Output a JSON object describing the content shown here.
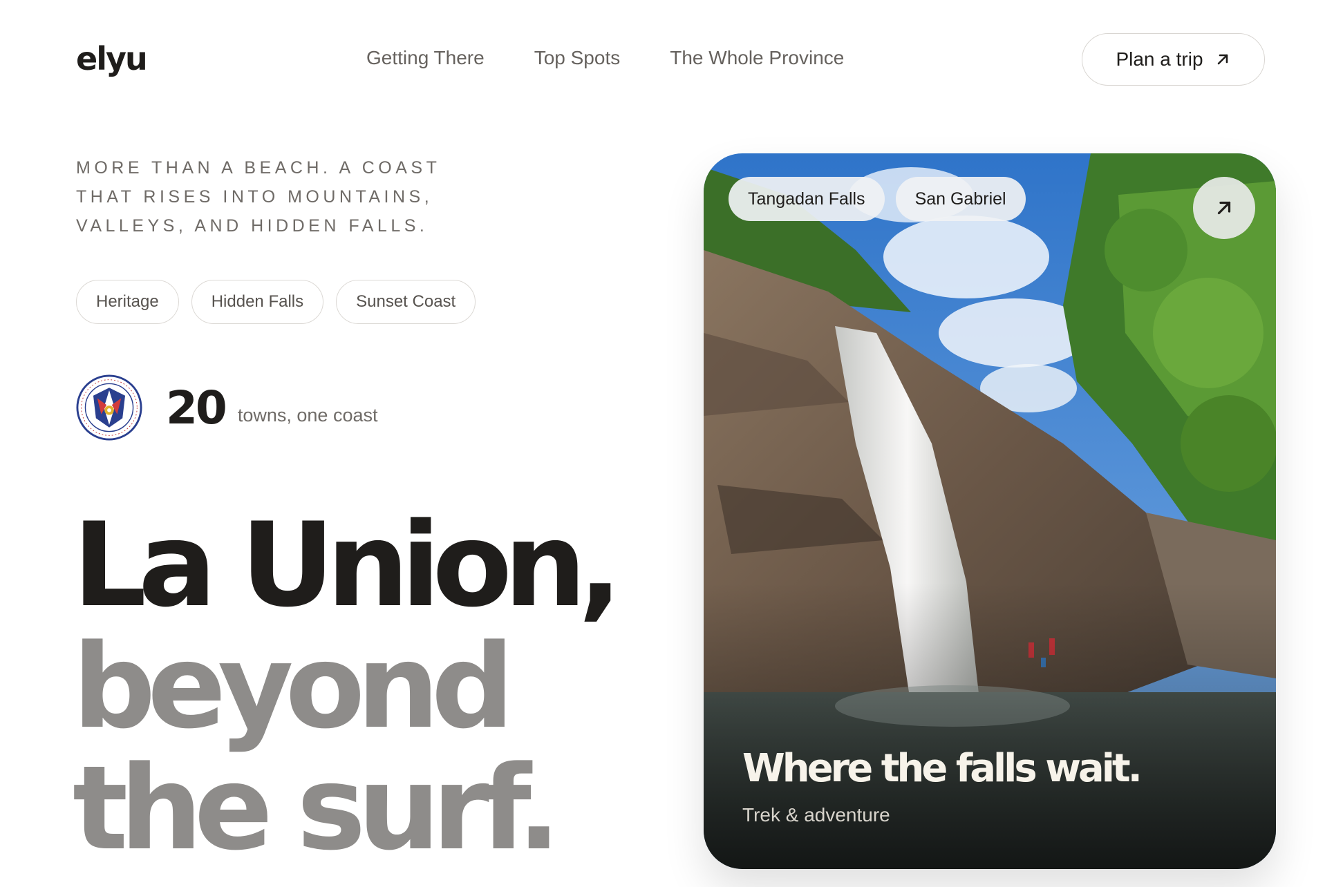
{
  "brand": {
    "logo": "elyu"
  },
  "nav": {
    "items": [
      "Getting There",
      "Top Spots",
      "The Whole Province"
    ]
  },
  "header": {
    "cta_label": "Plan a trip",
    "cta_icon": "arrow-up-right-icon"
  },
  "hero": {
    "tagline": "MORE THAN A BEACH. A COAST THAT RISES INTO MOUNTAINS, VALLEYS, AND HIDDEN FALLS.",
    "chips": [
      "Heritage",
      "Hidden Falls",
      "Sunset Coast"
    ],
    "stat": {
      "seal": "province-seal-icon",
      "value": "20",
      "label": "towns, one coast"
    },
    "headline": {
      "line1": "La Union,",
      "line2": "beyond",
      "line3": "the surf."
    }
  },
  "card": {
    "tags": [
      "Tangadan Falls",
      "San Gabriel"
    ],
    "open_icon": "arrow-up-right-icon",
    "title": "Where the falls wait.",
    "subtitle": "Trek & adventure"
  },
  "colors": {
    "text_dark": "#1f1d1b",
    "text_muted": "#8e8c8a",
    "chip_border": "#dcd9d5",
    "background": "#ffffff"
  }
}
